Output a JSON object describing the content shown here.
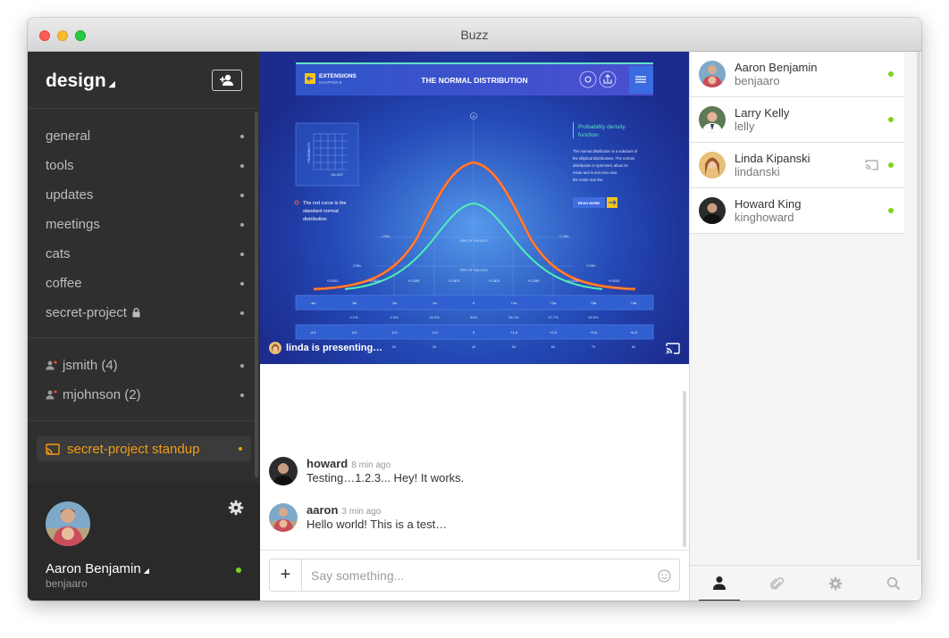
{
  "window": {
    "title": "Buzz"
  },
  "sidebar": {
    "team_name": "design",
    "channels": [
      {
        "label": "general"
      },
      {
        "label": "tools"
      },
      {
        "label": "updates"
      },
      {
        "label": "meetings"
      },
      {
        "label": "cats"
      },
      {
        "label": "coffee"
      },
      {
        "label": "secret-project",
        "locked": true
      }
    ],
    "direct_messages": [
      {
        "label": "jsmith (4)"
      },
      {
        "label": "mjohnson (2)"
      }
    ],
    "active_call": {
      "label": "secret-project standup",
      "color": "#f39c12"
    }
  },
  "current_user": {
    "name": "Aaron Benjamin",
    "username": "benjaaro",
    "status_color": "#7ed321"
  },
  "presentation": {
    "presenter_text": "linda is presenting…",
    "slide": {
      "section": "EXTENSIONS",
      "chapter": "CHAPTER 6",
      "title": "THE NORMAL DISTRIBUTION",
      "side_heading": "Probability density function",
      "side_text": "The normal distribution is a subclass of the elliptical distributions. The normal distribution is symmetric about its mean and is non-zero over the entire real line.",
      "read_more": "READ MORE",
      "note": "The red curve is the standard normal distribution",
      "mini_chart_y": "PROBABILITY",
      "mini_chart_x": "VALUES",
      "label_95": "95% OF VALUES",
      "label_99": "99% OF VALUES",
      "x_marker": "X",
      "sigma_row": [
        "-4σ",
        "-3σ",
        "-2σ",
        "-1σ",
        "0",
        "+1σ",
        "+2σ",
        "+3σ",
        "+4σ"
      ],
      "percent_row": [
        "0.1%",
        "2.3%",
        "15.9%",
        "50%",
        "84.1%",
        "97.7%",
        "99.9%"
      ],
      "z_row": [
        "-4.0",
        "-3.0",
        "-2.0",
        "-1.0",
        "0",
        "+1.0",
        "+2.0",
        "+3.0",
        "+4.0"
      ],
      "t_row": [
        "20",
        "30",
        "40",
        "50",
        "60",
        "70",
        "80"
      ],
      "density_labels": [
        "+0.0013",
        "+0.0214",
        "+0.1359",
        "+0.3413",
        "+0.3413",
        "+0.1359",
        "+0.0214",
        "+0.0013"
      ],
      "side_values": [
        "-1.96σ",
        "+1.96σ",
        "-2.58σ",
        "+2.58σ"
      ]
    }
  },
  "messages": [
    {
      "author": "howard",
      "time": "8 min ago",
      "text": "Testing…1.2.3... Hey! It works."
    },
    {
      "author": "aaron",
      "time": "3 min ago",
      "text": "Hello world! This is a test…"
    }
  ],
  "composer": {
    "add_label": "+",
    "placeholder": "Say something..."
  },
  "members": [
    {
      "name": "Aaron Benjamin",
      "username": "benjaaro",
      "online": true
    },
    {
      "name": "Larry Kelly",
      "username": "lelly",
      "online": true
    },
    {
      "name": "Linda Kipanski",
      "username": "lindanski",
      "online": true,
      "presenting": true
    },
    {
      "name": "Howard King",
      "username": "kinghoward",
      "online": true
    }
  ],
  "right_tabs": [
    "user-icon",
    "paperclip-icon",
    "gear-icon",
    "search-icon"
  ]
}
